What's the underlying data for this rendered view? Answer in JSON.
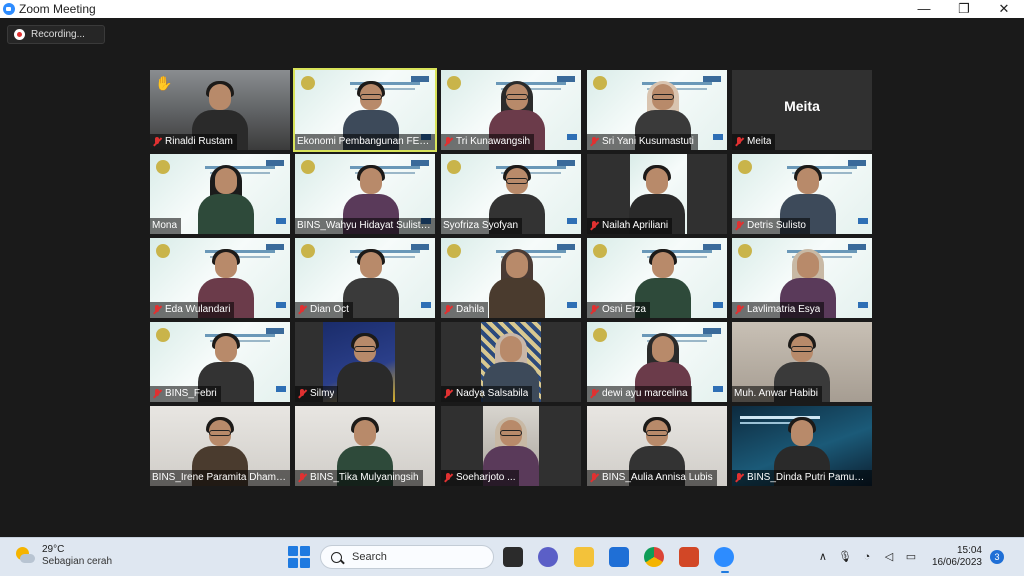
{
  "window": {
    "title": "Zoom Meeting",
    "minimize": "—",
    "restore": "❐",
    "close": "✕"
  },
  "recording": {
    "label": "Recording..."
  },
  "participants": [
    {
      "name": "Rinaldi Rustam",
      "muted": true,
      "hand_raised": true,
      "video": "car"
    },
    {
      "name": "Ekonomi Pembangunan FEB ...",
      "muted": false,
      "video": "slide",
      "active_speaker": true
    },
    {
      "name": "Tri Kunawangsih",
      "muted": true,
      "video": "slide"
    },
    {
      "name": "Sri Yani Kusumastuti",
      "muted": true,
      "video": "slide"
    },
    {
      "name": "Meita",
      "muted": true,
      "video": "off",
      "display_name_large": "Meita"
    },
    {
      "name": "Mona",
      "muted": false,
      "video": "slide"
    },
    {
      "name": "BINS_Wahyu Hidayat Sulisty...",
      "muted": false,
      "video": "slide"
    },
    {
      "name": "Syofriza Syofyan",
      "muted": false,
      "video": "slide"
    },
    {
      "name": "Nailah Apriliani",
      "muted": true,
      "video": "narrow"
    },
    {
      "name": "Detris Sulisto",
      "muted": true,
      "video": "slide"
    },
    {
      "name": "Eda Wulandari",
      "muted": true,
      "video": "slide"
    },
    {
      "name": "Dian Oct",
      "muted": true,
      "video": "slide"
    },
    {
      "name": "Dahila",
      "muted": true,
      "video": "slide"
    },
    {
      "name": "Osni Erza",
      "muted": true,
      "video": "slide"
    },
    {
      "name": "Lavlimatria Esya",
      "muted": true,
      "video": "slide"
    },
    {
      "name": "BINS_Febri",
      "muted": true,
      "video": "slide"
    },
    {
      "name": "Silmy",
      "muted": true,
      "video": "narrow-poster"
    },
    {
      "name": "Nadya Salsabila",
      "muted": true,
      "video": "pattern"
    },
    {
      "name": "dewi ayu marcelina",
      "muted": true,
      "video": "slide"
    },
    {
      "name": "Muh. Anwar Habibi",
      "muted": false,
      "video": "room"
    },
    {
      "name": "BINS_Irene Paramita Dhama...",
      "muted": false,
      "video": "wall"
    },
    {
      "name": "BINS_Tika Mulyaningsih",
      "muted": true,
      "video": "wall"
    },
    {
      "name": "Soeharjoto ...",
      "muted": true,
      "video": "narrow-small"
    },
    {
      "name": "BINS_Aulia Annisa Lubis",
      "muted": true,
      "video": "wall"
    },
    {
      "name": "BINS_Dinda Putri Pamun...",
      "muted": true,
      "video": "poster"
    }
  ],
  "taskbar": {
    "weather_temp": "29°C",
    "weather_desc": "Sebagian cerah",
    "search_placeholder": "Search",
    "time": "15:04",
    "date": "16/06/2023",
    "notification_count": "3",
    "tray_chevron": "∧",
    "tray_mic": "🎙",
    "tray_wifi": "◔",
    "tray_volume": "◁",
    "tray_battery": "▭"
  },
  "colors": {
    "background": "#1a1a1a",
    "active_speaker_border": "#d8e35a",
    "muted_icon": "#e03131",
    "taskbar": "#dfe7f1",
    "accent": "#1f7ae0"
  }
}
